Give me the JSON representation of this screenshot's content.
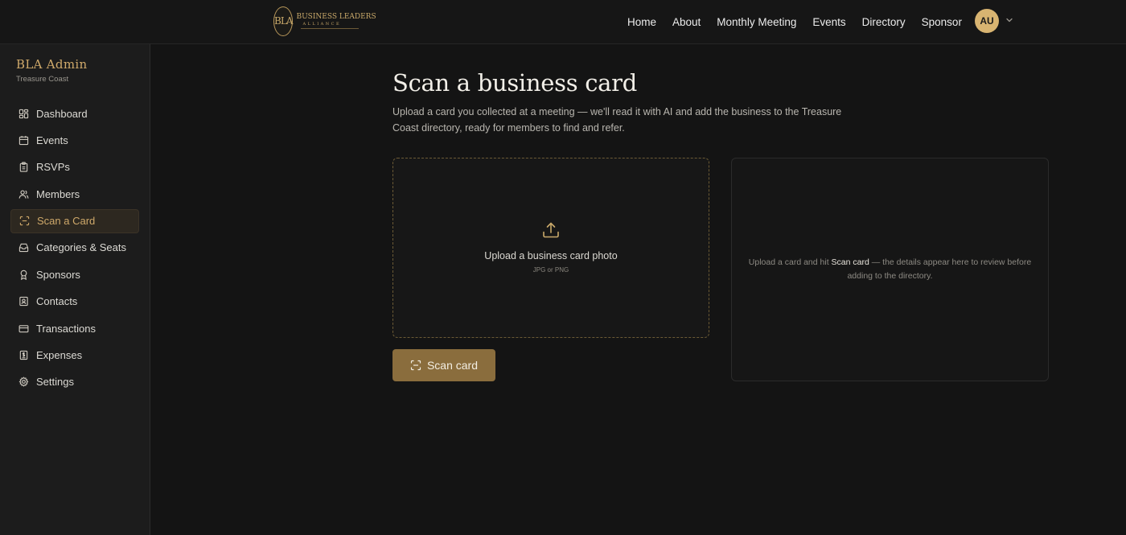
{
  "topnav": {
    "logo": {
      "monogram": "BLA",
      "name": "BUSINESS LEADERS",
      "sub": "ALLIANCE"
    },
    "links": [
      "Home",
      "About",
      "Monthly Meeting",
      "Events",
      "Directory",
      "Sponsor"
    ],
    "avatar_initials": "AU"
  },
  "sidebar": {
    "title": "BLA Admin",
    "subtitle": "Treasure Coast",
    "items": [
      {
        "label": "Dashboard",
        "icon": "dashboard-icon"
      },
      {
        "label": "Events",
        "icon": "calendar-icon"
      },
      {
        "label": "RSVPs",
        "icon": "clipboard-icon"
      },
      {
        "label": "Members",
        "icon": "users-icon"
      },
      {
        "label": "Scan a Card",
        "icon": "scan-icon",
        "active": true
      },
      {
        "label": "Categories & Seats",
        "icon": "inbox-icon"
      },
      {
        "label": "Sponsors",
        "icon": "award-icon"
      },
      {
        "label": "Contacts",
        "icon": "contact-icon"
      },
      {
        "label": "Transactions",
        "icon": "credit-card-icon"
      },
      {
        "label": "Expenses",
        "icon": "receipt-icon"
      },
      {
        "label": "Settings",
        "icon": "gear-icon"
      }
    ]
  },
  "main": {
    "title": "Scan a business card",
    "description": "Upload a card you collected at a meeting — we'll read it with AI and add the business to the Treasure Coast directory, ready for members to find and refer.",
    "upload": {
      "title": "Upload a business card photo",
      "subtitle": "JPG or PNG"
    },
    "scan_button": "Scan card",
    "preview": {
      "before": "Upload a card and hit ",
      "highlight": "Scan card",
      "after": " — the details appear here to review before adding to the directory."
    }
  },
  "colors": {
    "accent": "#cfa96a",
    "button": "#8a6d3d",
    "background": "#141414"
  }
}
